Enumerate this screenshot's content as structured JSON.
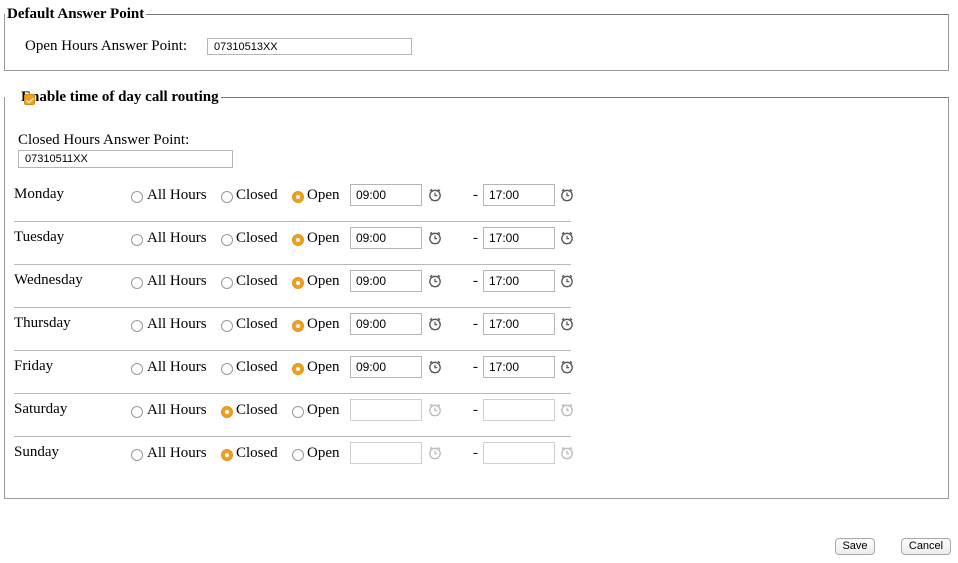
{
  "default_answer": {
    "legend": "Default Answer Point",
    "open_hours_label": "Open Hours Answer Point:",
    "open_hours_value": "07310513XX"
  },
  "routing": {
    "legend": "Enable time of day call routing",
    "enabled": true,
    "closed_hours_label": "Closed Hours Answer Point:",
    "closed_hours_value": "07310511XX",
    "option_labels": {
      "all_hours": "All Hours",
      "closed": "Closed",
      "open": "Open"
    },
    "separator": "-",
    "days": [
      {
        "name": "Monday",
        "mode": "open",
        "start": "09:00",
        "end": "17:00"
      },
      {
        "name": "Tuesday",
        "mode": "open",
        "start": "09:00",
        "end": "17:00"
      },
      {
        "name": "Wednesday",
        "mode": "open",
        "start": "09:00",
        "end": "17:00"
      },
      {
        "name": "Thursday",
        "mode": "open",
        "start": "09:00",
        "end": "17:00"
      },
      {
        "name": "Friday",
        "mode": "open",
        "start": "09:00",
        "end": "17:00"
      },
      {
        "name": "Saturday",
        "mode": "closed",
        "start": "",
        "end": ""
      },
      {
        "name": "Sunday",
        "mode": "closed",
        "start": "",
        "end": ""
      }
    ]
  },
  "actions": {
    "save": "Save",
    "cancel": "Cancel"
  },
  "colors": {
    "accent": "#f0a020",
    "border": "#9a9a9a",
    "clock_active": "#555555",
    "clock_disabled": "#bbbbbb"
  },
  "icons": {
    "time_picker": "clock-icon"
  }
}
